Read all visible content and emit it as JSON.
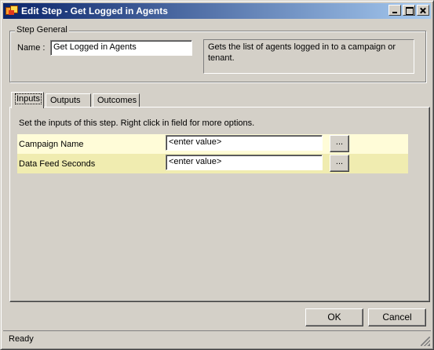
{
  "window": {
    "title": "Edit Step - Get Logged in Agents",
    "icon": "app-icon"
  },
  "step_general": {
    "legend": "Step General",
    "name_label": "Name :",
    "name_value": "Get Logged in Agents",
    "description": "Gets the list of agents logged in to a campaign or tenant."
  },
  "tabs": [
    {
      "label": "Inputs",
      "active": true
    },
    {
      "label": "Outputs",
      "active": false
    },
    {
      "label": "Outcomes",
      "active": false
    }
  ],
  "inputs_tab": {
    "instructions": "Set the inputs of this step.  Right click in field for more options.",
    "rows": [
      {
        "label": "Campaign Name",
        "value": "<enter value>",
        "button": "..."
      },
      {
        "label": "Data Feed Seconds",
        "value": "<enter value>",
        "button": "..."
      }
    ]
  },
  "buttons": {
    "ok": "OK",
    "cancel": "Cancel"
  },
  "status": {
    "text": "Ready"
  },
  "colors": {
    "title_gradient_start": "#0a246a",
    "title_gradient_end": "#a6caf0",
    "row_odd": "#fffcd8",
    "row_even": "#f0ecb0",
    "face": "#d4d0c8"
  }
}
